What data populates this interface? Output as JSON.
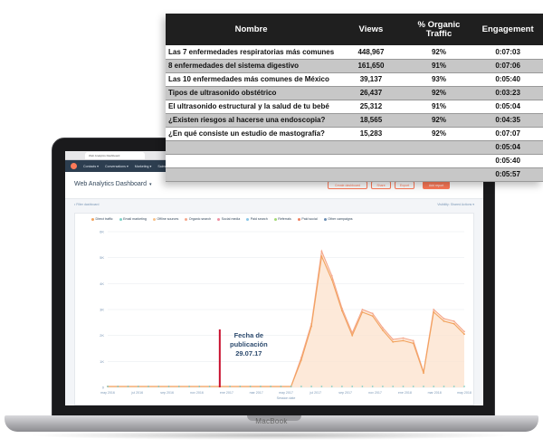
{
  "table": {
    "headers": {
      "name": "Nombre",
      "views": "Views",
      "organic": "% Organic Traffic",
      "engagement": "Engagement"
    },
    "rows": [
      {
        "name": "Las 7 enfermedades respiratorias más comunes",
        "views": "448,967",
        "organic": "92%",
        "engagement": "0:07:03"
      },
      {
        "name": "8 enfermedades del sistema digestivo",
        "views": "161,650",
        "organic": "91%",
        "engagement": "0:07:06"
      },
      {
        "name": "Las 10 enfermedades más comunes de México",
        "views": "39,137",
        "organic": "93%",
        "engagement": "0:05:40"
      },
      {
        "name": "Tipos de ultrasonido obstétrico",
        "views": "26,437",
        "organic": "92%",
        "engagement": "0:03:23"
      },
      {
        "name": "El ultrasonido estructural y la salud de tu bebé",
        "views": "25,312",
        "organic": "91%",
        "engagement": "0:05:04"
      },
      {
        "name": "¿Existen riesgos al hacerse una endoscopia?",
        "views": "18,565",
        "organic": "92%",
        "engagement": "0:04:35"
      },
      {
        "name": "¿En qué consiste un estudio de mastografía?",
        "views": "15,283",
        "organic": "92%",
        "engagement": "0:07:07"
      },
      {
        "name": "",
        "views": "",
        "organic": "",
        "engagement": "0:05:04"
      },
      {
        "name": "",
        "views": "",
        "organic": "",
        "engagement": "0:05:40"
      },
      {
        "name": "",
        "views": "",
        "organic": "",
        "engagement": "0:05:57"
      }
    ]
  },
  "laptop": {
    "brand": "MacBook"
  },
  "browser": {
    "tab_title": "Web Analytics Dashboard",
    "url": "app.hubspot.com"
  },
  "nav": {
    "items": [
      "Contacts ▾",
      "Conversations ▾",
      "Marketing ▾",
      "Sales ▾",
      "Tickets",
      "Automation ▾",
      "Reports ▾",
      "Partner ▾"
    ],
    "account": "Medical Account ▾"
  },
  "dashboard": {
    "title": "Web Analytics Dashboard",
    "caret": "▾",
    "buttons": {
      "create": "Create dashboard",
      "share": "Share",
      "export": "Export",
      "add": "Add report"
    },
    "filter_left": "• Filter dashboard",
    "filter_right": "Visibility: Shared   Actions ▾"
  },
  "chart_data": {
    "type": "area",
    "legend": [
      {
        "name": "Direct traffic",
        "color": "#f2a35e"
      },
      {
        "name": "Email marketing",
        "color": "#7fd1c7"
      },
      {
        "name": "Offline sources",
        "color": "#f7c28b"
      },
      {
        "name": "Organic search",
        "color": "#f5a78c"
      },
      {
        "name": "Social media",
        "color": "#ef8fa1"
      },
      {
        "name": "Paid search",
        "color": "#89c6e8"
      },
      {
        "name": "Referrals",
        "color": "#a3d977"
      },
      {
        "name": "Paid social",
        "color": "#f08060"
      },
      {
        "name": "Other campaigns",
        "color": "#6a8db3"
      }
    ],
    "y_ticks": [
      "0",
      "1K",
      "2K",
      "3K",
      "4K",
      "5K",
      "6K"
    ],
    "ylim": [
      0,
      6000
    ],
    "x_ticks": [
      "may 2016",
      "jul 2016",
      "sep 2016",
      "nov 2016",
      "ene 2017",
      "mar 2017",
      "may 2017",
      "jul 2017",
      "sep 2017",
      "nov 2017",
      "ene 2018",
      "mar 2018",
      "may 2018"
    ],
    "xlabel": "Session date",
    "series": [
      {
        "name": "Organic search",
        "color": "#f5a78c",
        "values": [
          40,
          40,
          40,
          40,
          40,
          40,
          40,
          40,
          40,
          40,
          40,
          40,
          40,
          40,
          40,
          40,
          40,
          40,
          40,
          1150,
          2450,
          5250,
          4300,
          3050,
          2100,
          3000,
          2850,
          2300,
          1850,
          1900,
          1800,
          600,
          3000,
          2650,
          2550,
          2150
        ]
      },
      {
        "name": "Direct traffic",
        "color": "#f2a35e",
        "values": [
          30,
          30,
          30,
          30,
          30,
          30,
          30,
          30,
          30,
          30,
          30,
          30,
          30,
          30,
          30,
          30,
          30,
          30,
          30,
          1050,
          2350,
          5050,
          4150,
          2950,
          2000,
          2900,
          2750,
          2200,
          1750,
          1800,
          1700,
          550,
          2900,
          2550,
          2450,
          2050
        ]
      }
    ],
    "annotation": {
      "line1": "Fecha de",
      "line2": "publicación",
      "line3": "29.07.17",
      "x_index": 11
    }
  }
}
